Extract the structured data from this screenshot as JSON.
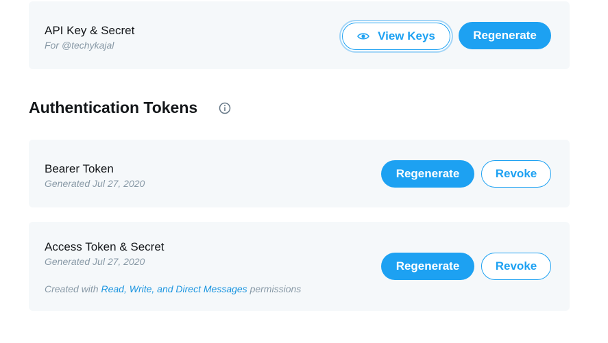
{
  "api_key_card": {
    "title": "API Key & Secret",
    "subtitle": "For @techykajal",
    "view_keys_label": "View Keys",
    "view_keys_icon": "eye-icon",
    "regenerate_label": "Regenerate"
  },
  "auth_section": {
    "heading": "Authentication Tokens",
    "info_icon": "info-icon"
  },
  "bearer_card": {
    "title": "Bearer Token",
    "subtitle": "Generated Jul 27, 2020",
    "regenerate_label": "Regenerate",
    "revoke_label": "Revoke"
  },
  "access_card": {
    "title": "Access Token & Secret",
    "subtitle": "Generated Jul 27, 2020",
    "permissions_prefix": "Created with ",
    "permissions_link": "Read, Write, and Direct Messages",
    "permissions_suffix": " permissions",
    "regenerate_label": "Regenerate",
    "revoke_label": "Revoke"
  },
  "colors": {
    "accent": "#1da1f2",
    "link": "#1b95e0",
    "card_bg": "#f5f8fa",
    "muted_text": "#8899a6",
    "heading_text": "#14171a"
  }
}
